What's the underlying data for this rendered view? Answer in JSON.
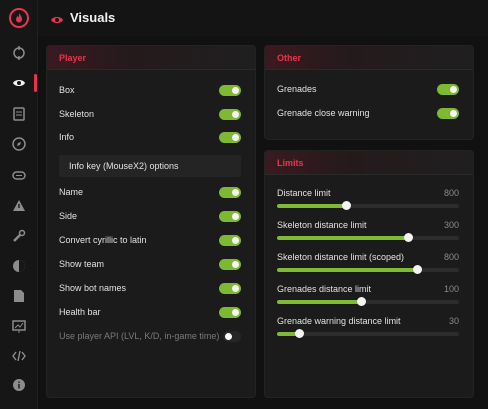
{
  "header": {
    "title": "Visuals"
  },
  "sidebar": {
    "icons": [
      "logo-icon",
      "crosshair-icon",
      "eye-icon",
      "list-icon",
      "compass-icon",
      "cloud-icon",
      "warning-icon",
      "wrench-icon",
      "palette-icon",
      "file-icon",
      "chart-icon",
      "code-icon",
      "info-icon"
    ],
    "active": "eye-icon"
  },
  "player": {
    "title": "Player",
    "toggles1": [
      {
        "label": "Box",
        "on": true
      },
      {
        "label": "Skeleton",
        "on": true
      },
      {
        "label": "Info",
        "on": true
      }
    ],
    "info_options_label": "Info key (MouseX2) options",
    "toggles2": [
      {
        "label": "Name",
        "on": true
      },
      {
        "label": "Side",
        "on": true
      },
      {
        "label": "Convert cyrillic to latin",
        "on": true
      },
      {
        "label": "Show team",
        "on": true
      },
      {
        "label": "Show bot names",
        "on": true
      },
      {
        "label": "Health bar",
        "on": true
      },
      {
        "label": "Use player API (LVL, K/D, in-game time)",
        "on": false
      }
    ]
  },
  "other": {
    "title": "Other",
    "toggles": [
      {
        "label": "Grenades",
        "on": true
      },
      {
        "label": "Grenade close warning",
        "on": true
      }
    ]
  },
  "limits": {
    "title": "Limits",
    "sliders": [
      {
        "label": "Distance limit",
        "value": "800",
        "fraction": 0.38
      },
      {
        "label": "Skeleton distance limit",
        "value": "300",
        "fraction": 0.72
      },
      {
        "label": "Skeleton distance limit (scoped)",
        "value": "800",
        "fraction": 0.77
      },
      {
        "label": "Grenades distance limit",
        "value": "100",
        "fraction": 0.46
      },
      {
        "label": "Grenade warning distance limit",
        "value": "30",
        "fraction": 0.12
      }
    ]
  },
  "colors": {
    "accent": "#e8344e",
    "toggle_on": "#7fb832"
  }
}
